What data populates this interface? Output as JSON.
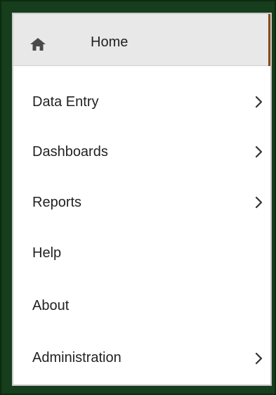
{
  "menu": {
    "home": {
      "label": "Home",
      "icon": "home-icon"
    },
    "items": [
      {
        "label": "Data Entry",
        "has_submenu": true
      },
      {
        "label": "Dashboards",
        "has_submenu": true
      },
      {
        "label": "Reports",
        "has_submenu": true
      },
      {
        "label": "Help",
        "has_submenu": false
      },
      {
        "label": "About",
        "has_submenu": false
      },
      {
        "label": "Administration",
        "has_submenu": true
      }
    ]
  },
  "colors": {
    "frame_background": "#163d1c",
    "menu_background": "#ffffff",
    "home_highlight": "#e8e8e8",
    "accent": "#8a4a14",
    "text": "#222222"
  }
}
